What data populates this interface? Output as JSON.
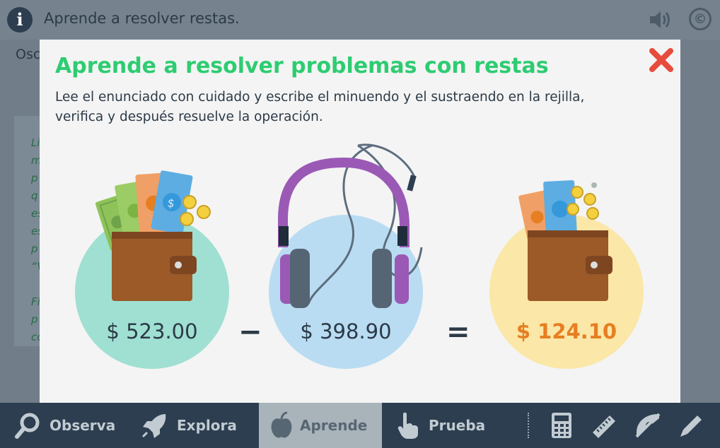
{
  "header": {
    "title": "Aprende a resolver restas.",
    "info_icon": "i"
  },
  "background": {
    "intro_text": "Osc",
    "card_lines": [
      "Li",
      "m",
      "p",
      "q",
      "es",
      "es",
      "p",
      "“V",
      "",
      "Fi",
      "p",
      "co"
    ]
  },
  "modal": {
    "title": "Aprende a resolver problemas con restas",
    "description": "Lee el enunciado con cuidado y escribe el minuendo y el sustraendo en la rejilla, verifica y después resuelve la operación.",
    "minuend": "$ 523.00",
    "operator_minus": "−",
    "subtrahend": "$ 398.90",
    "operator_equals": "=",
    "result": "$ 124.10"
  },
  "nav": {
    "items": [
      {
        "label": "Observa",
        "icon": "magnifier-icon"
      },
      {
        "label": "Explora",
        "icon": "rocket-icon"
      },
      {
        "label": "Aprende",
        "icon": "apple-icon",
        "active": true
      },
      {
        "label": "Prueba",
        "icon": "hand-pointer-icon"
      }
    ],
    "tools": [
      "calculator-icon",
      "ruler-icon",
      "protractor-icon",
      "pencil-icon"
    ]
  },
  "colors": {
    "title_green": "#2ecc71",
    "result_orange": "#e67e22",
    "close_red": "#e74c3c",
    "nav_bg": "#2c3e50"
  }
}
